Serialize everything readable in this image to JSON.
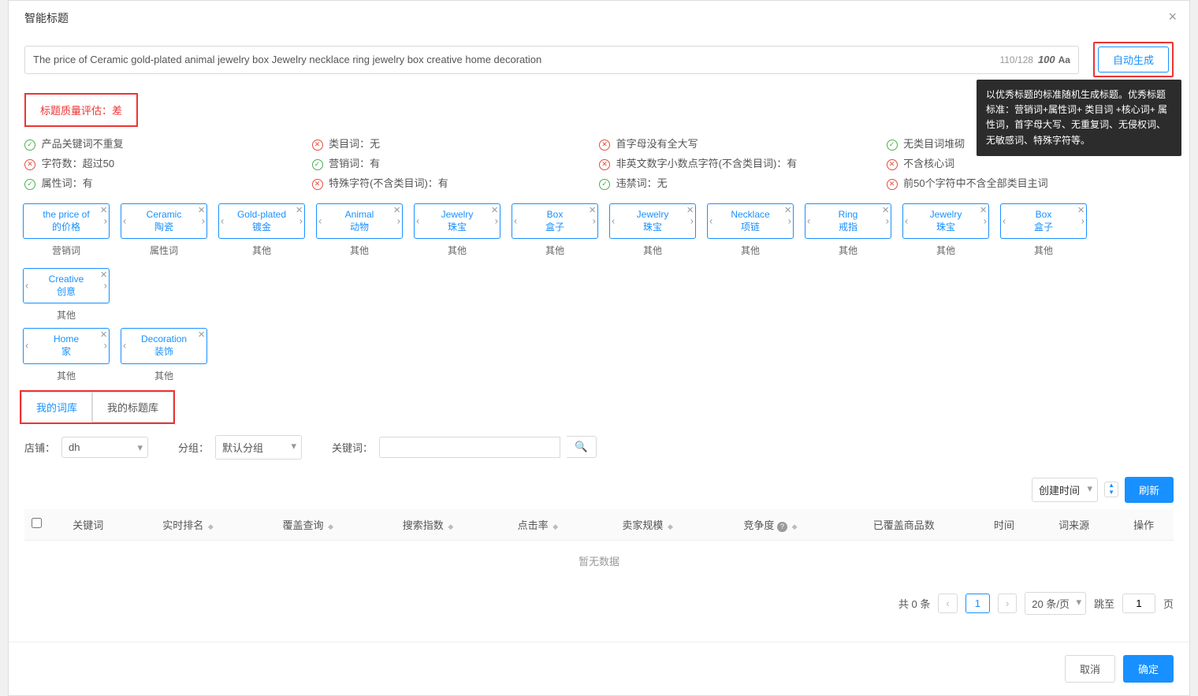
{
  "modal": {
    "title": "智能标题",
    "title_input": "The price of Ceramic gold-plated animal jewelry box Jewelry necklace ring jewelry box creative home decoration",
    "char_count": "110/128",
    "score_label": "100",
    "aa_label": "Aa",
    "auto_gen": "自动生成",
    "tooltip": "以优秀标题的标准随机生成标题。优秀标题标准：营销词+属性词+ 类目词 +核心词+ 属性词，首字母大写、无重复词、无侵权词、无敏感词、特殊字符等。",
    "eval": "标题质量评估：差"
  },
  "checks": [
    [
      {
        "ok": true,
        "t": "产品关键词不重复"
      },
      {
        "ok": false,
        "t": "字符数：超过50"
      },
      {
        "ok": true,
        "t": "属性词：有"
      }
    ],
    [
      {
        "ok": false,
        "t": "类目词：无"
      },
      {
        "ok": true,
        "t": "营销词：有"
      },
      {
        "ok": false,
        "t": "特殊字符(不含类目词)：有"
      }
    ],
    [
      {
        "ok": false,
        "t": "首字母没有全大写"
      },
      {
        "ok": false,
        "t": "非英文数字小数点字符(不含类目词)：有"
      },
      {
        "ok": true,
        "t": "违禁词：无"
      }
    ],
    [
      {
        "ok": true,
        "t": "无类目词堆砌"
      },
      {
        "ok": false,
        "t": "不含核心词"
      },
      {
        "ok": false,
        "t": "前50个字符中不含全部类目主词"
      }
    ]
  ],
  "tags_row1": [
    {
      "en": "the price of",
      "zh": "的价格",
      "label": "营销词",
      "no_left": true
    },
    {
      "en": "Ceramic",
      "zh": "陶瓷",
      "label": "属性词"
    },
    {
      "en": "Gold-plated",
      "zh": "镀金",
      "label": "其他"
    },
    {
      "en": "Animal",
      "zh": "动物",
      "label": "其他"
    },
    {
      "en": "Jewelry",
      "zh": "珠宝",
      "label": "其他"
    },
    {
      "en": "Box",
      "zh": "盒子",
      "label": "其他"
    },
    {
      "en": "Jewelry",
      "zh": "珠宝",
      "label": "其他"
    },
    {
      "en": "Necklace",
      "zh": "项链",
      "label": "其他"
    },
    {
      "en": "Ring",
      "zh": "戒指",
      "label": "其他"
    },
    {
      "en": "Jewelry",
      "zh": "珠宝",
      "label": "其他"
    },
    {
      "en": "Box",
      "zh": "盒子",
      "label": "其他"
    },
    {
      "en": "Creative",
      "zh": "创意",
      "label": "其他"
    }
  ],
  "tags_row2": [
    {
      "en": "Home",
      "zh": "家",
      "label": "其他"
    },
    {
      "en": "Decoration",
      "zh": "装饰",
      "label": "其他",
      "no_right": true
    }
  ],
  "lib_tabs": {
    "t1": "我的词库",
    "t2": "我的标题库"
  },
  "filters": {
    "shop_label": "店铺：",
    "shop_val": "dh",
    "group_label": "分组：",
    "group_val": "默认分组",
    "kw_label": "关键词：",
    "kw_val": ""
  },
  "actions": {
    "sort": "创建时间",
    "refresh": "刷新"
  },
  "table": {
    "cols": [
      "关键词",
      "实时排名",
      "覆盖查询",
      "搜索指数",
      "点击率",
      "卖家规模",
      "竞争度",
      "已覆盖商品数",
      "时间",
      "词来源",
      "操作"
    ],
    "empty": "暂无数据"
  },
  "pager": {
    "total": "共 0 条",
    "cur": "1",
    "size": "20 条/页",
    "jump_label": "跳至",
    "jump_val": "1",
    "page_label": "页"
  },
  "footer": {
    "cancel": "取消",
    "ok": "确定"
  }
}
